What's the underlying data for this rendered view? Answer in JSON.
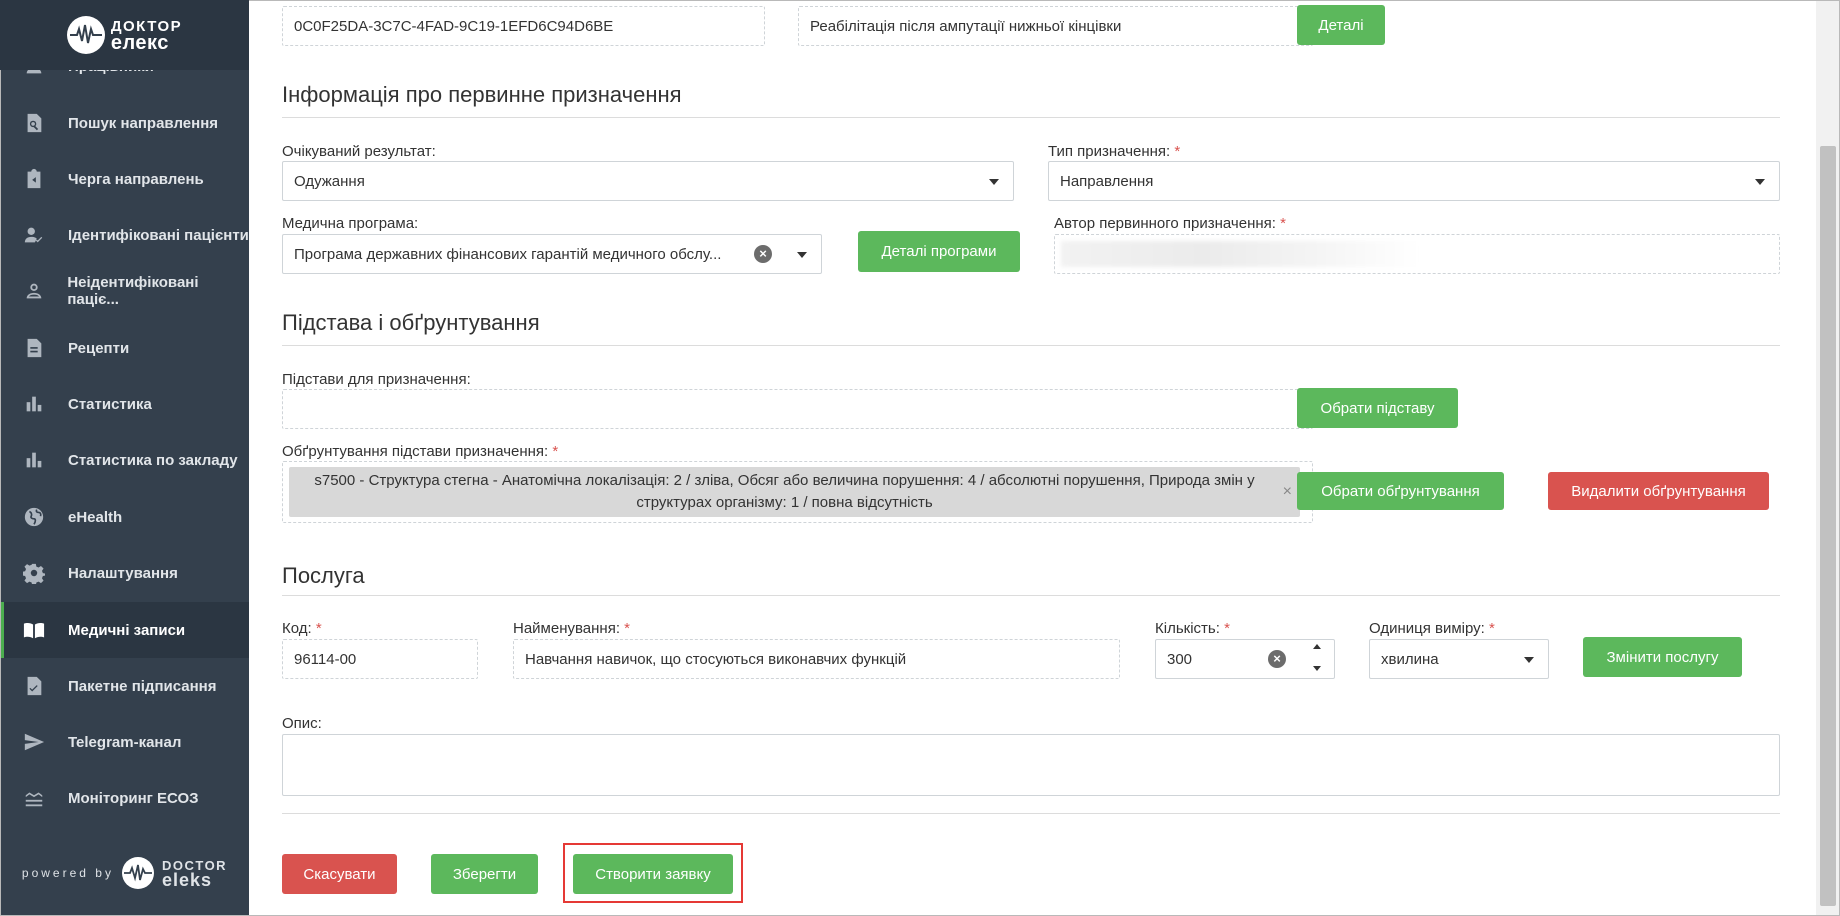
{
  "sidebar": {
    "logo": {
      "line1": "ДОКТОР",
      "line2": "елекс"
    },
    "items": [
      {
        "label": "Працівники",
        "icon": "person-icon"
      },
      {
        "label": "Пошук направлення",
        "icon": "search-document-icon"
      },
      {
        "label": "Черга направлень",
        "icon": "clipboard-arrow-icon"
      },
      {
        "label": "Ідентифіковані пацієнти",
        "icon": "person-check-icon"
      },
      {
        "label": "Неідентифіковані паціє...",
        "icon": "person-outline-icon"
      },
      {
        "label": "Рецепти",
        "icon": "document-icon"
      },
      {
        "label": "Статистика",
        "icon": "bar-chart-icon"
      },
      {
        "label": "Статистика по закладу",
        "icon": "bar-chart-icon"
      },
      {
        "label": "eHealth",
        "icon": "globe-icon"
      },
      {
        "label": "Налаштування",
        "icon": "gear-icon"
      },
      {
        "label": "Медичні записи",
        "icon": "book-icon",
        "active": true
      },
      {
        "label": "Пакетне підписання",
        "icon": "document-sign-icon"
      },
      {
        "label": "Telegram-канал",
        "icon": "send-icon"
      },
      {
        "label": "Моніторинг ЕСОЗ",
        "icon": "wave-icon"
      }
    ],
    "powered": {
      "prefix": "powered by",
      "line1": "DOCTOR",
      "line2": "eleks"
    }
  },
  "top": {
    "id_value": "0C0F25DA-3C7C-4FAD-9C19-1EFD6C94D6BE",
    "name_value": "Реабілітація після ампутації нижньої кінцівки",
    "details_button": "Деталі"
  },
  "primary": {
    "title": "Інформація про первинне призначення",
    "expected_result_label": "Очікуваний результат:",
    "expected_result_value": "Одужання",
    "type_label": "Тип призначення:",
    "type_value": "Направлення",
    "program_label": "Медична програма:",
    "program_value": "Програма державних фінансових гарантій медичного обслу...",
    "program_details_button": "Деталі програми",
    "author_label": "Автор первинного призначення:"
  },
  "basis": {
    "title": "Підстава і обґрунтування",
    "reasons_label": "Підстави для призначення:",
    "choose_reason_button": "Обрати підставу",
    "justification_label": "Обґрунтування підстави призначення:",
    "justification_tag": "s7500 - Структура стегна - Анатомічна локалізація: 2 / зліва, Обсяг або величина порушення: 4 / абсолютні порушення, Природа змін у структурах організму: 1 / повна відсутність",
    "choose_justification_button": "Обрати обґрунтування",
    "delete_justification_button": "Видалити обґрунтування"
  },
  "service": {
    "title": "Послуга",
    "code_label": "Код:",
    "code_value": "96114-00",
    "name_label": "Найменування:",
    "name_value": "Навчання навичок, що стосуються виконавчих функцій",
    "qty_label": "Кількість:",
    "qty_value": "300",
    "unit_label": "Одиниця виміру:",
    "unit_value": "хвилина",
    "change_service_button": "Змінити послугу",
    "description_label": "Опис:"
  },
  "actions": {
    "cancel": "Скасувати",
    "save": "Зберегти",
    "create": "Створити заявку"
  },
  "colors": {
    "green": "#5cb85c",
    "red": "#d9534f",
    "sidebar": "#34404d",
    "highlight": "#e53935"
  }
}
